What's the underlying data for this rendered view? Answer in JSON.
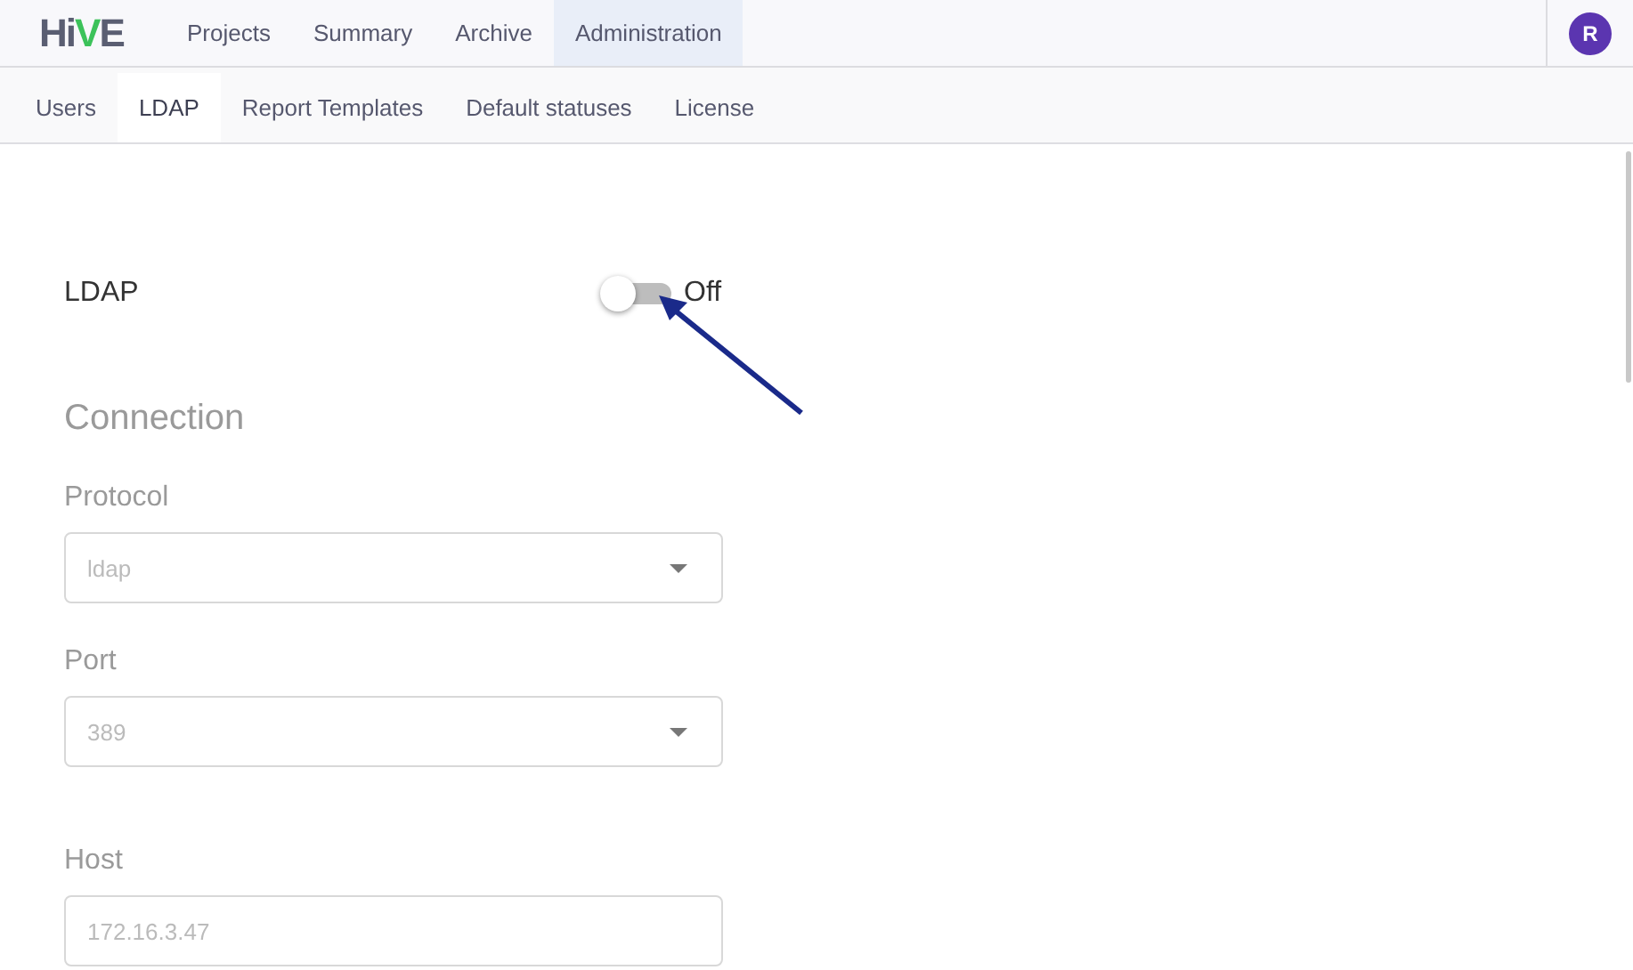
{
  "logo": [
    {
      "text": "Hi",
      "accent": false
    },
    {
      "text": "V",
      "accent": true
    },
    {
      "text": "E",
      "accent": false
    }
  ],
  "nav": [
    {
      "label": "Projects",
      "selected": false
    },
    {
      "label": "Summary",
      "selected": false
    },
    {
      "label": "Archive",
      "selected": false
    },
    {
      "label": "Administration",
      "selected": true
    }
  ],
  "avatar": "R",
  "tabs": [
    {
      "label": "Users",
      "selected": false
    },
    {
      "label": "LDAP",
      "selected": true
    },
    {
      "label": "Report Templates",
      "selected": false
    },
    {
      "label": "Default statuses",
      "selected": false
    },
    {
      "label": "License",
      "selected": false
    }
  ],
  "ldap": {
    "label": "LDAP",
    "on": false,
    "state_text": "Off"
  },
  "connection": {
    "title": "Connection",
    "disabled": true,
    "fields": [
      {
        "kind": "select",
        "label": "Protocol",
        "value": "ldap"
      },
      {
        "kind": "select",
        "label": "Port",
        "value": "389"
      },
      {
        "kind": "text",
        "label": "Host",
        "value": "172.16.3.47"
      }
    ]
  }
}
